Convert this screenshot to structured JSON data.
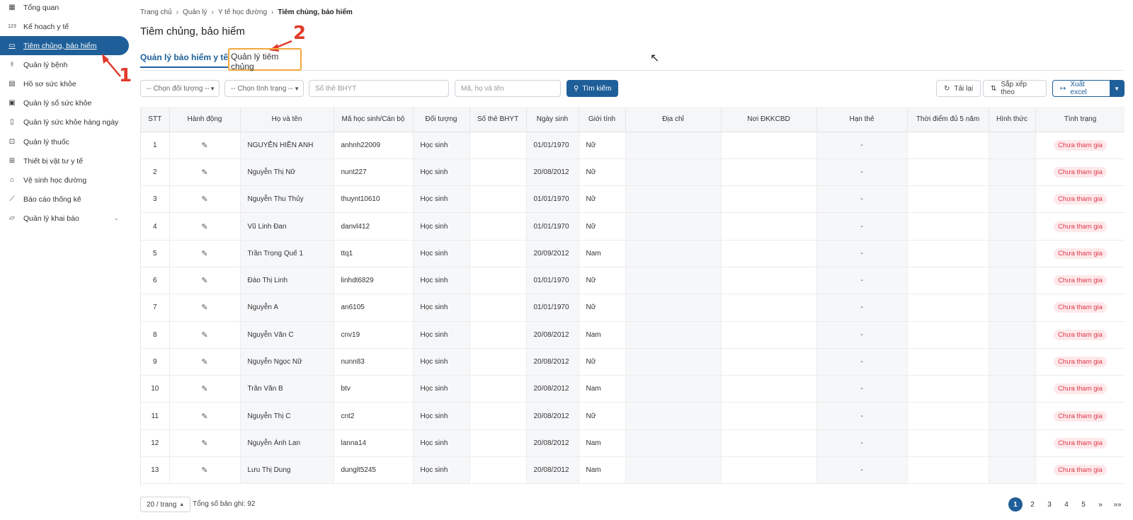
{
  "sidebar": {
    "items": [
      {
        "label": "Tổng quan",
        "icon": "dashboard-icon"
      },
      {
        "label": "Kế hoạch y tế",
        "icon": "numbers-icon",
        "glyph": "123"
      },
      {
        "label": "Tiêm chủng, bảo hiểm",
        "icon": "id-card-icon",
        "active": true
      },
      {
        "label": "Quản lý bệnh",
        "icon": "stethoscope-icon"
      },
      {
        "label": "Hồ sơ sức khỏe",
        "icon": "document-icon"
      },
      {
        "label": "Quản lý sổ sức khỏe",
        "icon": "contact-book-icon"
      },
      {
        "label": "Quản lý sức khỏe hàng ngày",
        "icon": "book-icon"
      },
      {
        "label": "Quản lý thuốc",
        "icon": "medicine-icon"
      },
      {
        "label": "Thiết bị vật tư y tế",
        "icon": "medical-kit-icon"
      },
      {
        "label": "Vệ sinh học đường",
        "icon": "school-icon"
      },
      {
        "label": "Báo cáo thống kê",
        "icon": "chart-line-icon"
      },
      {
        "label": "Quản lý khai báo",
        "icon": "folder-icon",
        "expandable": true
      }
    ]
  },
  "annotations": {
    "one": "1",
    "two": "2"
  },
  "breadcrumb": {
    "items": [
      "Trang chủ",
      "Quản lý",
      "Y tế học đường"
    ],
    "current": "Tiêm chủng, bảo hiểm"
  },
  "page_title": "Tiêm chủng, bảo hiểm",
  "tabs": {
    "insurance": "Quản lý bảo hiểm y tế",
    "vaccination": "Quản lý tiêm chủng"
  },
  "filters": {
    "subject_select": "-- Chọn đối tượng --",
    "status_select": "-- Chọn tình trạng --",
    "bhyt_placeholder": "Số thẻ BHYT",
    "name_placeholder": "Mã, họ và tên",
    "search_label": "Tìm kiếm"
  },
  "actions": {
    "reload": "Tải lại",
    "sort": "Sắp xếp theo",
    "export": "Xuất excel"
  },
  "table": {
    "headers": [
      "STT",
      "Hành động",
      "Họ và tên",
      "Mã học sinh/Cán bộ",
      "Đối tượng",
      "Số thẻ BHYT",
      "Ngày sinh",
      "Giới tính",
      "Địa chỉ",
      "Nơi ĐKKCBD",
      "Hạn thẻ",
      "Thời điểm đủ 5 năm",
      "Hình thức",
      "Tình trạng"
    ],
    "rows": [
      {
        "stt": "1",
        "name": "NGUYỄN HIỀN ANH",
        "code": "anhnh22009",
        "subject": "Học sinh",
        "dob": "01/01/1970",
        "gender": "Nữ",
        "expiry": "-",
        "status": "Chưa tham gia"
      },
      {
        "stt": "2",
        "name": "Nguyễn Thị Nữ",
        "code": "nunt227",
        "subject": "Học sinh",
        "dob": "20/08/2012",
        "gender": "Nữ",
        "expiry": "-",
        "status": "Chưa tham gia"
      },
      {
        "stt": "3",
        "name": "Nguyễn Thu Thủy",
        "code": "thuynt10610",
        "subject": "Học sinh",
        "dob": "01/01/1970",
        "gender": "Nữ",
        "expiry": "-",
        "status": "Chưa tham gia"
      },
      {
        "stt": "4",
        "name": "Vũ Linh Đan",
        "code": "danvl412",
        "subject": "Học sinh",
        "dob": "01/01/1970",
        "gender": "Nữ",
        "expiry": "-",
        "status": "Chưa tham gia"
      },
      {
        "stt": "5",
        "name": "Trần Trọng Quế 1",
        "code": "ttq1",
        "subject": "Học sinh",
        "dob": "20/09/2012",
        "gender": "Nam",
        "expiry": "-",
        "status": "Chưa tham gia"
      },
      {
        "stt": "6",
        "name": "Đào Thị Linh",
        "code": "linhdt6829",
        "subject": "Học sinh",
        "dob": "01/01/1970",
        "gender": "Nữ",
        "expiry": "-",
        "status": "Chưa tham gia"
      },
      {
        "stt": "7",
        "name": "Nguyễn A",
        "code": "an6105",
        "subject": "Học sinh",
        "dob": "01/01/1970",
        "gender": "Nữ",
        "expiry": "-",
        "status": "Chưa tham gia"
      },
      {
        "stt": "8",
        "name": "Nguyễn Văn C",
        "code": "cnv19",
        "subject": "Học sinh",
        "dob": "20/08/2012",
        "gender": "Nam",
        "expiry": "-",
        "status": "Chưa tham gia"
      },
      {
        "stt": "9",
        "name": "Nguyễn Ngọc Nữ",
        "code": "nunn83",
        "subject": "Học sinh",
        "dob": "20/08/2012",
        "gender": "Nữ",
        "expiry": "-",
        "status": "Chưa tham gia"
      },
      {
        "stt": "10",
        "name": "Trần Văn B",
        "code": "btv",
        "subject": "Học sinh",
        "dob": "20/08/2012",
        "gender": "Nam",
        "expiry": "-",
        "status": "Chưa tham gia"
      },
      {
        "stt": "11",
        "name": "Nguyễn Thị C",
        "code": "cnt2",
        "subject": "Học sinh",
        "dob": "20/08/2012",
        "gender": "Nữ",
        "expiry": "-",
        "status": "Chưa tham gia"
      },
      {
        "stt": "12",
        "name": "Nguyễn Ánh Lan",
        "code": "lanna14",
        "subject": "Học sinh",
        "dob": "20/08/2012",
        "gender": "Nam",
        "expiry": "-",
        "status": "Chưa tham gia"
      },
      {
        "stt": "13",
        "name": "Lưu Thị Dung",
        "code": "dunglt5245",
        "subject": "Học sinh",
        "dob": "20/08/2012",
        "gender": "Nam",
        "expiry": "-",
        "status": "Chưa tham gia"
      }
    ]
  },
  "footer": {
    "page_size": "20 / trang",
    "total": "Tổng số bản ghi: 92"
  },
  "pagination": {
    "pages": [
      "1",
      "2",
      "3",
      "4",
      "5"
    ],
    "current": "1",
    "next": "»",
    "last": "»»"
  },
  "colors": {
    "primary": "#1f5f99",
    "status_bg": "#fde8ea",
    "status_text": "#e0394a",
    "highlight": "#f0a83c",
    "annotation": "#e03a2a"
  }
}
